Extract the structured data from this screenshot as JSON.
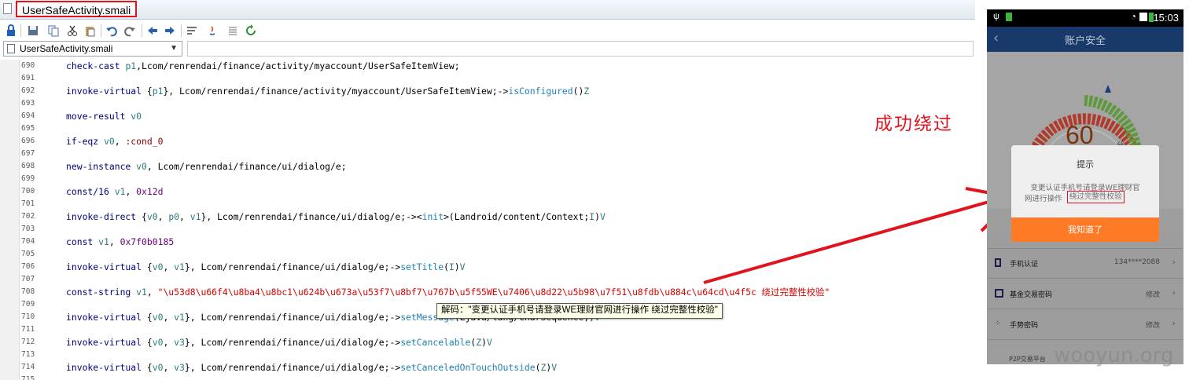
{
  "editor": {
    "tab_title": "UserSafeActivity.smali",
    "file_select": "UserSafeActivity.smali",
    "toolbar_icons": [
      "lock-icon",
      "save-icon",
      "copy-icon",
      "cut-icon",
      "paste-icon",
      "undo-icon",
      "redo-icon",
      "back-icon",
      "forward-icon",
      "word-wrap-icon",
      "java-icon",
      "align-icon",
      "refresh-icon"
    ],
    "lines": [
      {
        "n": "690",
        "t": [
          [
            "kw",
            "check-cast "
          ],
          [
            "reg",
            "p1"
          ],
          [
            "",
            ","
          ],
          [
            "",
            "Lcom/renrendai/finance/activity/myaccount/UserSafeItemView;"
          ]
        ]
      },
      {
        "n": "691",
        "t": []
      },
      {
        "n": "692",
        "t": [
          [
            "kw",
            "invoke-virtual "
          ],
          [
            "",
            "{"
          ],
          [
            "reg",
            "p1"
          ],
          [
            "",
            "}, Lcom/renrendai/finance/activity/myaccount/UserSafeItemView;->"
          ],
          [
            "mth",
            "isConfigured"
          ],
          [
            "",
            "()"
          ],
          [
            "reg",
            "Z"
          ]
        ]
      },
      {
        "n": "693",
        "t": []
      },
      {
        "n": "694",
        "t": [
          [
            "kw",
            "move-result "
          ],
          [
            "reg",
            "v0"
          ]
        ]
      },
      {
        "n": "695",
        "t": []
      },
      {
        "n": "696",
        "t": [
          [
            "kw",
            "if-eqz "
          ],
          [
            "reg",
            "v0"
          ],
          [
            "",
            ", "
          ],
          [
            "lbl",
            ":cond_0"
          ]
        ]
      },
      {
        "n": "697",
        "t": []
      },
      {
        "n": "698",
        "t": [
          [
            "kw",
            "new-instance "
          ],
          [
            "reg",
            "v0"
          ],
          [
            "",
            ", Lcom/renrendai/finance/ui/dialog/e;"
          ]
        ]
      },
      {
        "n": "699",
        "t": []
      },
      {
        "n": "700",
        "t": [
          [
            "kw",
            "const/16 "
          ],
          [
            "reg",
            "v1"
          ],
          [
            "",
            ", "
          ],
          [
            "num",
            "0x12d"
          ]
        ]
      },
      {
        "n": "701",
        "t": []
      },
      {
        "n": "702",
        "t": [
          [
            "kw",
            "invoke-direct "
          ],
          [
            "",
            "{"
          ],
          [
            "reg",
            "v0"
          ],
          [
            "",
            ", "
          ],
          [
            "reg",
            "p0"
          ],
          [
            "",
            ", "
          ],
          [
            "reg",
            "v1"
          ],
          [
            "",
            "}, Lcom/renrendai/finance/ui/dialog/e;-><"
          ],
          [
            "mth",
            "init"
          ],
          [
            "",
            ">(Landroid/content/Context;"
          ],
          [
            "reg",
            "I"
          ],
          [
            "",
            ")"
          ],
          [
            "reg",
            "V"
          ]
        ]
      },
      {
        "n": "703",
        "t": []
      },
      {
        "n": "704",
        "t": [
          [
            "kw",
            "const "
          ],
          [
            "reg",
            "v1"
          ],
          [
            "",
            ", "
          ],
          [
            "num",
            "0x7f0b0185"
          ]
        ]
      },
      {
        "n": "705",
        "t": []
      },
      {
        "n": "706",
        "t": [
          [
            "kw",
            "invoke-virtual "
          ],
          [
            "",
            "{"
          ],
          [
            "reg",
            "v0"
          ],
          [
            "",
            ", "
          ],
          [
            "reg",
            "v1"
          ],
          [
            "",
            "}, Lcom/renrendai/finance/ui/dialog/e;->"
          ],
          [
            "mth",
            "setTitle"
          ],
          [
            "",
            "("
          ],
          [
            "reg",
            "I"
          ],
          [
            "",
            ")"
          ],
          [
            "reg",
            "V"
          ]
        ]
      },
      {
        "n": "707",
        "t": []
      },
      {
        "n": "708",
        "t": [
          [
            "kw",
            "const-string "
          ],
          [
            "reg",
            "v1"
          ],
          [
            "",
            ", "
          ],
          [
            "str",
            "\"\\u53d8\\u66f4\\u8ba4\\u8bc1\\u624b\\u673a\\u53f7\\u8bf7\\u767b\\u5f55WE\\u7406\\u8d22\\u5b98\\u7f51\\u8fdb\\u884c\\u64cd\\u4f5c 绕过完整性校验\""
          ]
        ]
      },
      {
        "n": "709",
        "t": []
      },
      {
        "n": "710",
        "t": [
          [
            "kw",
            "invoke-virtual "
          ],
          [
            "",
            "{"
          ],
          [
            "reg",
            "v0"
          ],
          [
            "",
            ", "
          ],
          [
            "reg",
            "v1"
          ],
          [
            "",
            "}, Lcom/renrendai/finance/ui/dialog/e;->"
          ],
          [
            "mth",
            "setMessage"
          ],
          [
            "",
            "(Ljava/lang/CharSequence;)"
          ],
          [
            "reg",
            "V"
          ]
        ]
      },
      {
        "n": "711",
        "t": []
      },
      {
        "n": "712",
        "t": [
          [
            "kw",
            "invoke-virtual "
          ],
          [
            "",
            "{"
          ],
          [
            "reg",
            "v0"
          ],
          [
            "",
            ", "
          ],
          [
            "reg",
            "v3"
          ],
          [
            "",
            "}, Lcom/renrendai/finance/ui/dialog/e;->"
          ],
          [
            "mth",
            "setCancelable"
          ],
          [
            "",
            "("
          ],
          [
            "reg",
            "Z"
          ],
          [
            "",
            ")"
          ],
          [
            "reg",
            "V"
          ]
        ]
      },
      {
        "n": "713",
        "t": []
      },
      {
        "n": "714",
        "t": [
          [
            "kw",
            "invoke-virtual "
          ],
          [
            "",
            "{"
          ],
          [
            "reg",
            "v0"
          ],
          [
            "",
            ", "
          ],
          [
            "reg",
            "v3"
          ],
          [
            "",
            "}, Lcom/renrendai/finance/ui/dialog/e;->"
          ],
          [
            "mth",
            "setCanceledOnTouchOutside"
          ],
          [
            "",
            "("
          ],
          [
            "reg",
            "Z"
          ],
          [
            "",
            ")"
          ],
          [
            "reg",
            "V"
          ]
        ]
      },
      {
        "n": "715",
        "t": []
      }
    ],
    "tooltip": "解码：\"变更认证手机号请登录WE理财官网进行操作 绕过完整性校验\""
  },
  "annotation": "成功绕过",
  "phone": {
    "time": "15:03",
    "nav_title": "账户安全",
    "score": "60",
    "score_unit": "分",
    "dialog": {
      "title": "提示",
      "line1": "变更认证手机号请登录WE理财官",
      "line2_prefix": "网进行操作",
      "line2_highlight": "绕过完整性校验",
      "button": "我知道了"
    },
    "items": [
      {
        "name": "手机认证",
        "value": "134****2088",
        "icon": "phone-icon"
      },
      {
        "name": "基金交易密码",
        "value": "修改",
        "icon": "lock-icon"
      },
      {
        "name": "手势密码",
        "value": "修改",
        "icon": "gesture-icon"
      }
    ],
    "footer": "P2P交易平台"
  },
  "watermark": "wooyun.org",
  "colors": {
    "highlight_red": "#e0141e",
    "dialog_button": "#ff7a27",
    "nav_blue": "#19396b"
  }
}
